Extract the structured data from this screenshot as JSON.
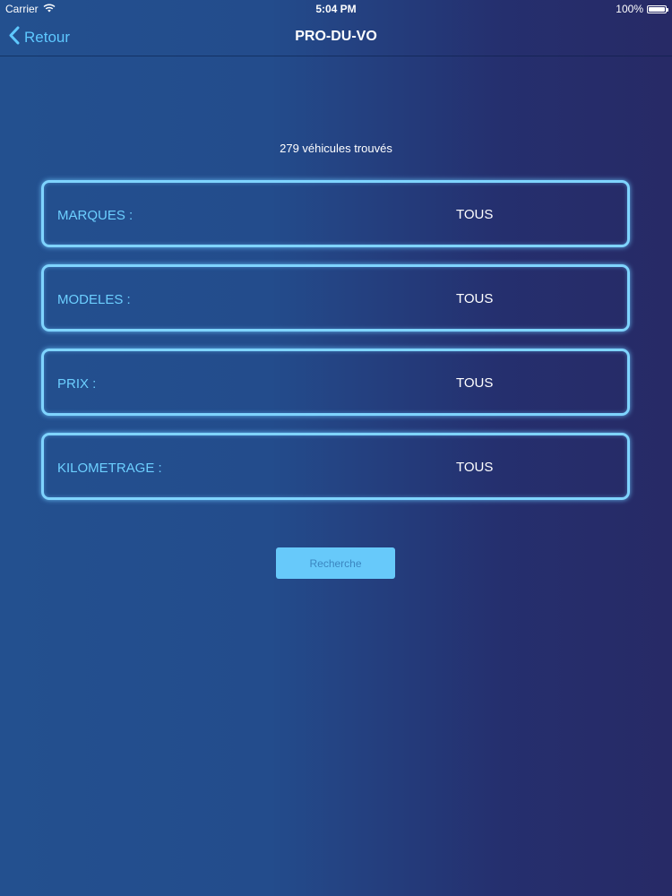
{
  "status_bar": {
    "carrier": "Carrier",
    "time": "5:04 PM",
    "battery": "100%",
    "battery_level": 1.0
  },
  "nav": {
    "back_label": "Retour",
    "title": "PRO-DU-VO"
  },
  "result_count": "279 véhicules trouvés",
  "filters": [
    {
      "label": "MARQUES :",
      "value": "TOUS"
    },
    {
      "label": "MODELES :",
      "value": "TOUS"
    },
    {
      "label": "PRIX :",
      "value": "TOUS"
    },
    {
      "label": "KILOMETRAGE :",
      "value": "TOUS"
    }
  ],
  "search_button": {
    "label": "Recherche"
  },
  "colors": {
    "accent": "#5ec8ff",
    "border_glow": "#7fd4ff",
    "button_bg": "#67c9fa"
  },
  "icons": {
    "wifi": "wifi-icon",
    "back": "chevron-left-icon",
    "battery": "battery-icon"
  }
}
